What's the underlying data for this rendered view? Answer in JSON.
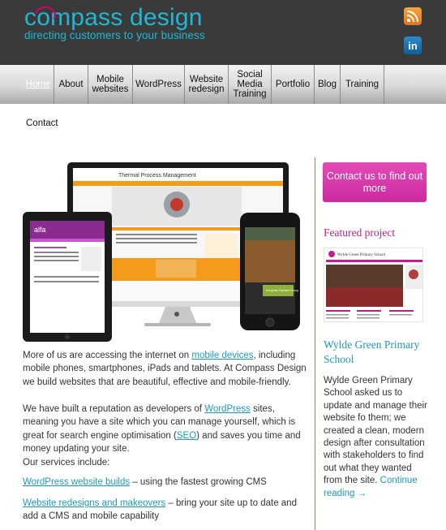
{
  "header": {
    "logo_pre": "c",
    "logo_o": "o",
    "logo_post": "mpass design",
    "tagline": "directing customers to your business",
    "rss_icon": "rss-icon",
    "linkedin_icon": "linkedin-icon",
    "linkedin_label": "in"
  },
  "nav": {
    "items": [
      {
        "label": "Home"
      },
      {
        "label": "About"
      },
      {
        "label": "Mobile websites"
      },
      {
        "label": "WordPress"
      },
      {
        "label": "Website redesign"
      },
      {
        "label": "Social Media Training"
      },
      {
        "label": "Portfolio"
      },
      {
        "label": "Blog"
      },
      {
        "label": "Training"
      }
    ],
    "contact": "Contact"
  },
  "hero": {
    "monitor_heading": "Thermal Process Management",
    "tablet_brand": "alfa",
    "phone_brand": "European Partners Group"
  },
  "content": {
    "p1_a": "More of us are accessing the internet on ",
    "p1_link": "mobile devices",
    "p1_b": ", including mobile phones, smartphones, iPads and tablets. At Compass Design we build websites that are beautiful, effective and mobile-friendly.",
    "p2_a": "We have built a reputation as developers of ",
    "p2_link1": "WordPress",
    "p2_b": " sites, meaning you have a site which you can manage yourself, which is great for search engine optimisation (",
    "p2_link2": "SEO",
    "p2_c": ") and saves you time and money updating your site.",
    "p3": "Our services include:",
    "p4_link": "WordPress website builds",
    "p4_b": " – using the fastest growing CMS",
    "p5_link": "Website redesigns and makeovers",
    "p5_b": " – bring your site up to date and add a CMS and mobile capability"
  },
  "sidebar": {
    "cta": "Contact us to find out more",
    "featured_heading": "Featured project",
    "thumb_title": "Wylde Green Primary School",
    "featured_title": "Wylde Green Primary School",
    "featured_text": "Wylde Green Primary School asked us to update and manage their website fo them; we created a clean, modern design after consultation with stakeholders to find out what they wanted from the site. ",
    "featured_link": "Continue reading →"
  },
  "colors": {
    "header_bg": "#3a3a3a",
    "brand_cyan": "#1fb7d6",
    "brand_magenta": "#c21d8f",
    "link": "#1a9bbd",
    "sidebar_divider": "#a8825e"
  }
}
